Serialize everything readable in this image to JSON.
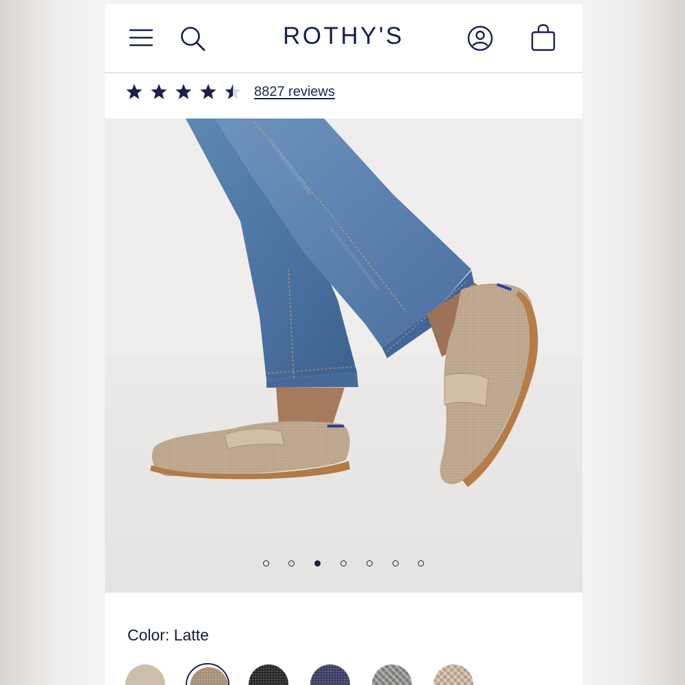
{
  "header": {
    "brand": "ROTHY'S",
    "icons": [
      "menu-icon",
      "search-icon",
      "account-icon",
      "shopping-bag-icon"
    ]
  },
  "rating": {
    "value": 4.5,
    "max": 5,
    "reviews_label": "8827 reviews",
    "star_color": "#1b2147"
  },
  "hero": {
    "image": "model wearing straight-leg blue jeans and latte knit driving loafers",
    "slide_count": 7,
    "active_slide": 3
  },
  "color": {
    "label": "Color:",
    "selected": "Latte",
    "swatches": [
      {
        "color": "#cdbfab",
        "pattern": "solid"
      },
      {
        "color": "#a58f76",
        "pattern": "knit"
      },
      {
        "color": "#262626",
        "pattern": "knit"
      },
      {
        "color": "#3b3c63",
        "pattern": "knit"
      },
      {
        "color": "#8c8a87",
        "pattern": "chevron"
      },
      {
        "color": "#c9b29a",
        "pattern": "chevron"
      }
    ]
  },
  "colors": {
    "navy": "#14204a",
    "background": "#ffffff"
  }
}
